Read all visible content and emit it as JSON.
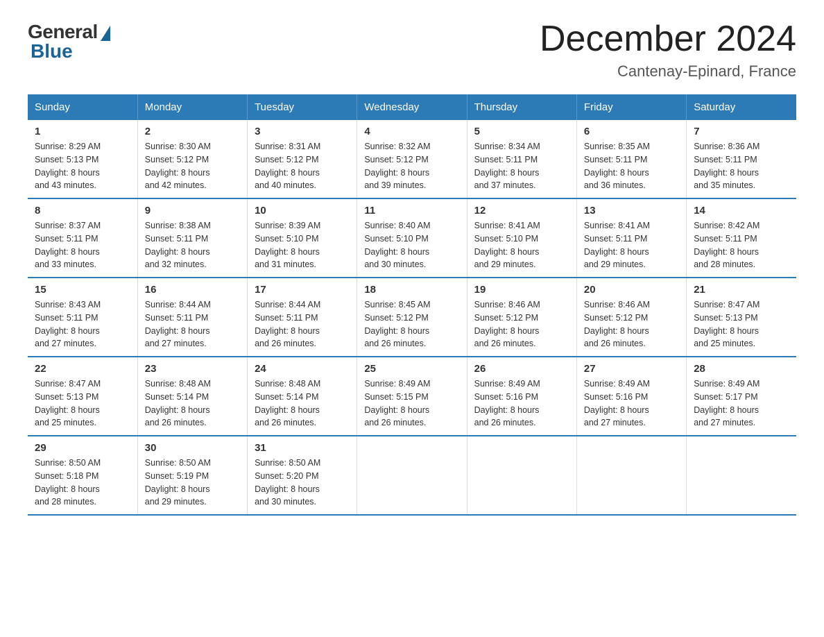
{
  "logo": {
    "general": "General",
    "blue": "Blue"
  },
  "header": {
    "month": "December 2024",
    "location": "Cantenay-Epinard, France"
  },
  "days_of_week": [
    "Sunday",
    "Monday",
    "Tuesday",
    "Wednesday",
    "Thursday",
    "Friday",
    "Saturday"
  ],
  "weeks": [
    [
      {
        "day": "1",
        "sunrise": "8:29 AM",
        "sunset": "5:13 PM",
        "daylight": "8 hours and 43 minutes."
      },
      {
        "day": "2",
        "sunrise": "8:30 AM",
        "sunset": "5:12 PM",
        "daylight": "8 hours and 42 minutes."
      },
      {
        "day": "3",
        "sunrise": "8:31 AM",
        "sunset": "5:12 PM",
        "daylight": "8 hours and 40 minutes."
      },
      {
        "day": "4",
        "sunrise": "8:32 AM",
        "sunset": "5:12 PM",
        "daylight": "8 hours and 39 minutes."
      },
      {
        "day": "5",
        "sunrise": "8:34 AM",
        "sunset": "5:11 PM",
        "daylight": "8 hours and 37 minutes."
      },
      {
        "day": "6",
        "sunrise": "8:35 AM",
        "sunset": "5:11 PM",
        "daylight": "8 hours and 36 minutes."
      },
      {
        "day": "7",
        "sunrise": "8:36 AM",
        "sunset": "5:11 PM",
        "daylight": "8 hours and 35 minutes."
      }
    ],
    [
      {
        "day": "8",
        "sunrise": "8:37 AM",
        "sunset": "5:11 PM",
        "daylight": "8 hours and 33 minutes."
      },
      {
        "day": "9",
        "sunrise": "8:38 AM",
        "sunset": "5:11 PM",
        "daylight": "8 hours and 32 minutes."
      },
      {
        "day": "10",
        "sunrise": "8:39 AM",
        "sunset": "5:10 PM",
        "daylight": "8 hours and 31 minutes."
      },
      {
        "day": "11",
        "sunrise": "8:40 AM",
        "sunset": "5:10 PM",
        "daylight": "8 hours and 30 minutes."
      },
      {
        "day": "12",
        "sunrise": "8:41 AM",
        "sunset": "5:10 PM",
        "daylight": "8 hours and 29 minutes."
      },
      {
        "day": "13",
        "sunrise": "8:41 AM",
        "sunset": "5:11 PM",
        "daylight": "8 hours and 29 minutes."
      },
      {
        "day": "14",
        "sunrise": "8:42 AM",
        "sunset": "5:11 PM",
        "daylight": "8 hours and 28 minutes."
      }
    ],
    [
      {
        "day": "15",
        "sunrise": "8:43 AM",
        "sunset": "5:11 PM",
        "daylight": "8 hours and 27 minutes."
      },
      {
        "day": "16",
        "sunrise": "8:44 AM",
        "sunset": "5:11 PM",
        "daylight": "8 hours and 27 minutes."
      },
      {
        "day": "17",
        "sunrise": "8:44 AM",
        "sunset": "5:11 PM",
        "daylight": "8 hours and 26 minutes."
      },
      {
        "day": "18",
        "sunrise": "8:45 AM",
        "sunset": "5:12 PM",
        "daylight": "8 hours and 26 minutes."
      },
      {
        "day": "19",
        "sunrise": "8:46 AM",
        "sunset": "5:12 PM",
        "daylight": "8 hours and 26 minutes."
      },
      {
        "day": "20",
        "sunrise": "8:46 AM",
        "sunset": "5:12 PM",
        "daylight": "8 hours and 26 minutes."
      },
      {
        "day": "21",
        "sunrise": "8:47 AM",
        "sunset": "5:13 PM",
        "daylight": "8 hours and 25 minutes."
      }
    ],
    [
      {
        "day": "22",
        "sunrise": "8:47 AM",
        "sunset": "5:13 PM",
        "daylight": "8 hours and 25 minutes."
      },
      {
        "day": "23",
        "sunrise": "8:48 AM",
        "sunset": "5:14 PM",
        "daylight": "8 hours and 26 minutes."
      },
      {
        "day": "24",
        "sunrise": "8:48 AM",
        "sunset": "5:14 PM",
        "daylight": "8 hours and 26 minutes."
      },
      {
        "day": "25",
        "sunrise": "8:49 AM",
        "sunset": "5:15 PM",
        "daylight": "8 hours and 26 minutes."
      },
      {
        "day": "26",
        "sunrise": "8:49 AM",
        "sunset": "5:16 PM",
        "daylight": "8 hours and 26 minutes."
      },
      {
        "day": "27",
        "sunrise": "8:49 AM",
        "sunset": "5:16 PM",
        "daylight": "8 hours and 27 minutes."
      },
      {
        "day": "28",
        "sunrise": "8:49 AM",
        "sunset": "5:17 PM",
        "daylight": "8 hours and 27 minutes."
      }
    ],
    [
      {
        "day": "29",
        "sunrise": "8:50 AM",
        "sunset": "5:18 PM",
        "daylight": "8 hours and 28 minutes."
      },
      {
        "day": "30",
        "sunrise": "8:50 AM",
        "sunset": "5:19 PM",
        "daylight": "8 hours and 29 minutes."
      },
      {
        "day": "31",
        "sunrise": "8:50 AM",
        "sunset": "5:20 PM",
        "daylight": "8 hours and 30 minutes."
      },
      null,
      null,
      null,
      null
    ]
  ],
  "labels": {
    "sunrise": "Sunrise:",
    "sunset": "Sunset:",
    "daylight": "Daylight:"
  }
}
